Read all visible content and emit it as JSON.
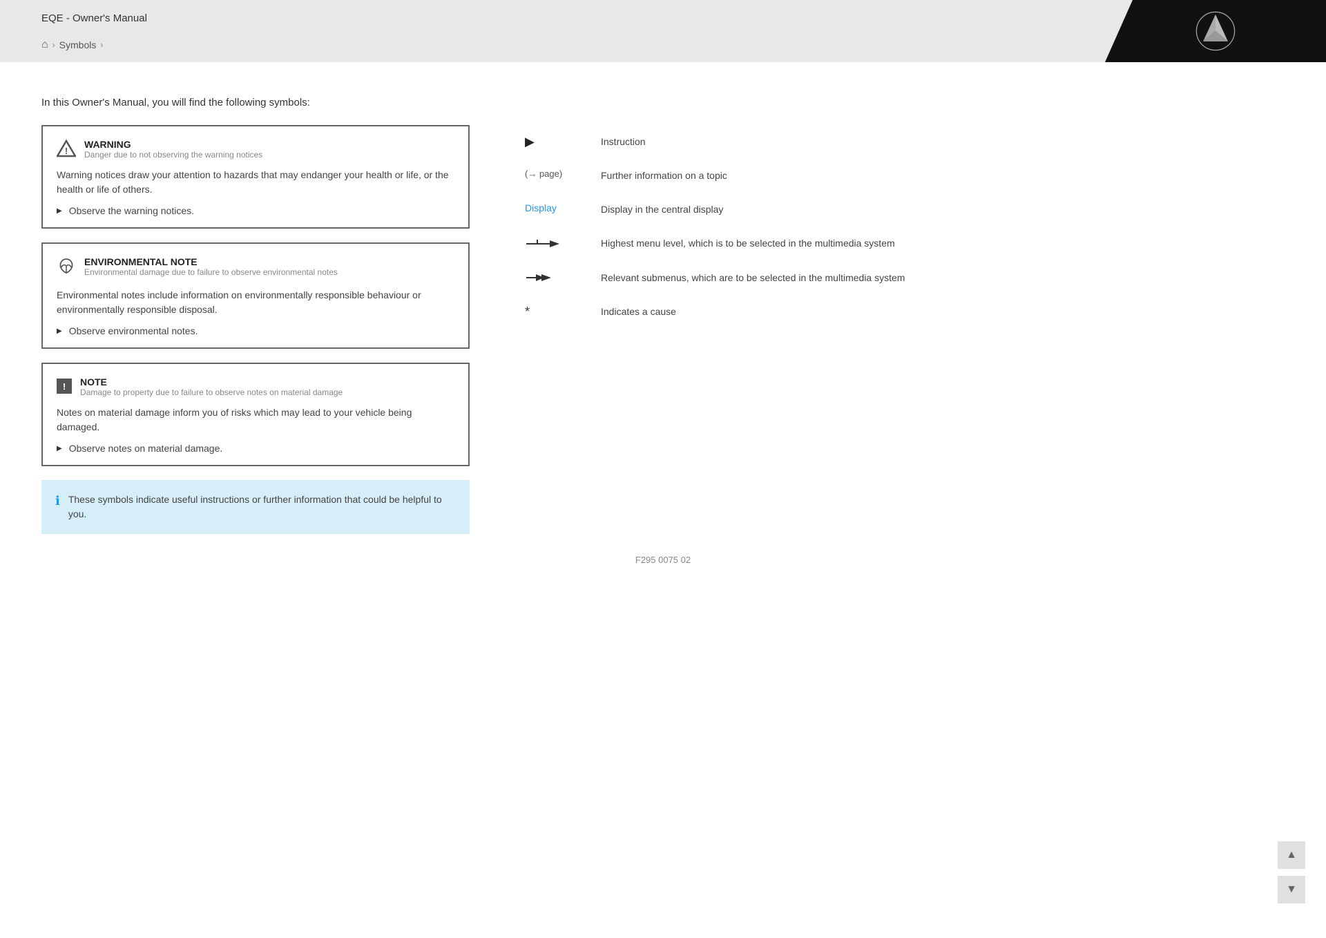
{
  "header": {
    "title": "EQE - Owner's Manual",
    "breadcrumb": {
      "home_label": "🏠",
      "separator": "›",
      "current": "Symbols"
    }
  },
  "main": {
    "intro": "In this Owner's Manual, you will find the following symbols:",
    "notices": [
      {
        "id": "warning",
        "title": "WARNING",
        "subtitle": "Danger due to not observing the warning notices",
        "body": "Warning notices draw your attention to hazards that may endanger your health or life, or the health or life of others.",
        "instruction": "Observe the warning notices."
      },
      {
        "id": "environmental",
        "title": "ENVIRONMENTAL NOTE",
        "subtitle": "Environmental damage due to failure to observe environmental notes",
        "body": "Environmental notes include information on environmentally responsible behaviour or environmentally responsible disposal.",
        "instruction": "Observe environmental notes."
      },
      {
        "id": "note",
        "title": "NOTE",
        "subtitle": "Damage to property due to failure to observe notes on material damage",
        "body": "Notes on material damage inform you of risks which may lead to your vehicle being damaged.",
        "instruction": "Observe notes on material damage."
      }
    ],
    "info_box": "These symbols indicate useful instructions or further information that could be helpful to you.",
    "symbols": [
      {
        "id": "instruction",
        "icon_type": "play",
        "description": "Instruction"
      },
      {
        "id": "further_info",
        "icon_type": "arrow_page",
        "icon_text": "(→ page)",
        "description": "Further information on a topic"
      },
      {
        "id": "display",
        "icon_type": "display",
        "icon_text": "Display",
        "description": "Display in the central display"
      },
      {
        "id": "menu_level",
        "icon_type": "arrow_right",
        "description": "Highest menu level, which is to be selected in the multimedia system"
      },
      {
        "id": "submenus",
        "icon_type": "double_arrow",
        "description": "Relevant submenus, which are to be selected in the multimedia system"
      },
      {
        "id": "cause",
        "icon_type": "asterisk",
        "icon_text": "*",
        "description": "Indicates a cause"
      }
    ],
    "footer_code": "F295 0075 02"
  }
}
